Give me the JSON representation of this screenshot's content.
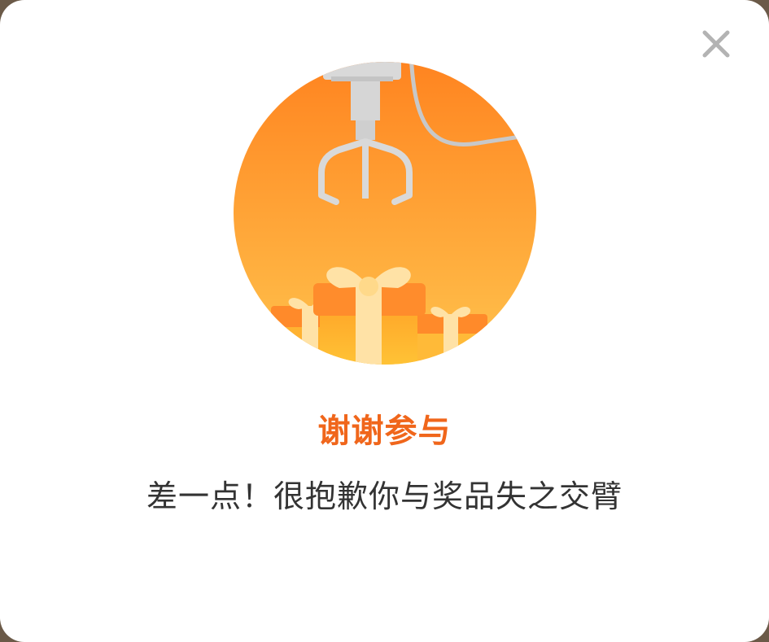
{
  "dialog": {
    "title": "谢谢参与",
    "message": "差一点！很抱歉你与奖品失之交臂",
    "close_icon": "close-icon",
    "illustration_icon": "claw-machine-gift-icon"
  },
  "colors": {
    "title": "#f0661b",
    "message": "#333333",
    "circle_top": "#ff8420",
    "circle_bottom": "#ffc34d",
    "close": "#b3b3b3"
  }
}
